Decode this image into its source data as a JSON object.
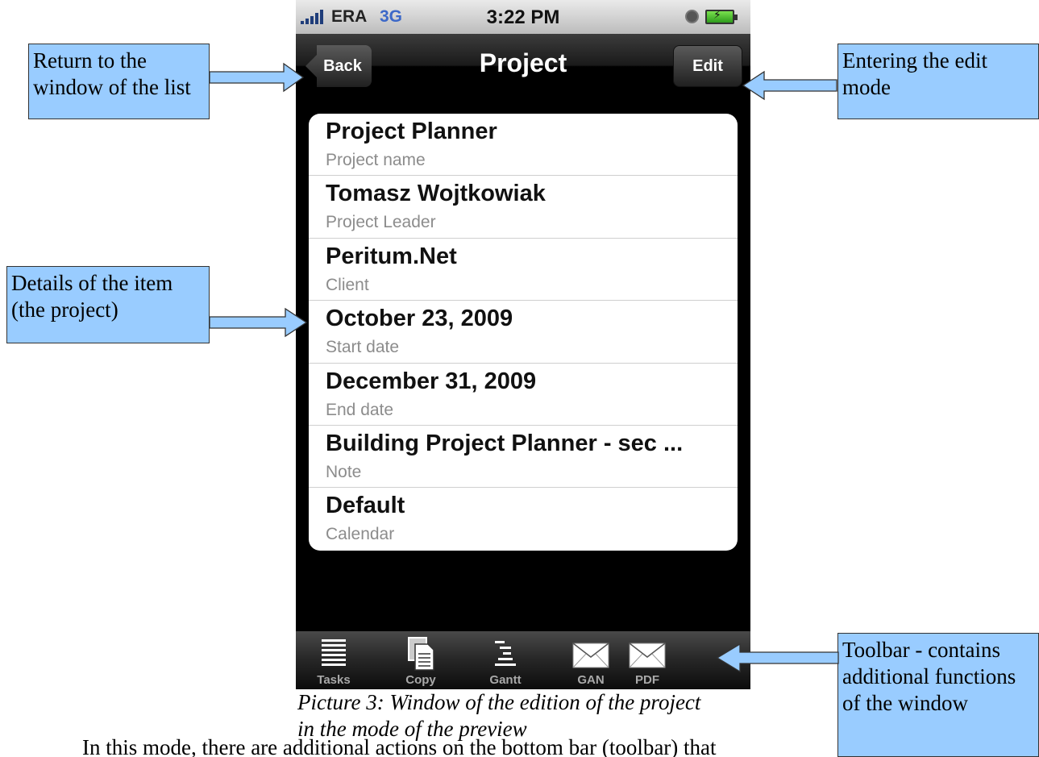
{
  "status_bar": {
    "carrier": "ERA",
    "network": "3G",
    "time": "3:22 PM"
  },
  "nav": {
    "back_label": "Back",
    "title": "Project",
    "edit_label": "Edit"
  },
  "fields": [
    {
      "value": "Project Planner",
      "label": "Project name"
    },
    {
      "value": "Tomasz Wojtkowiak",
      "label": "Project Leader"
    },
    {
      "value": "Peritum.Net",
      "label": "Client"
    },
    {
      "value": "October 23, 2009",
      "label": "Start date"
    },
    {
      "value": "December 31, 2009",
      "label": "End date"
    },
    {
      "value": "Building Project Planner - sec ...",
      "label": "Note"
    },
    {
      "value": "Default",
      "label": "Calendar"
    }
  ],
  "toolbar": [
    {
      "label": "Tasks",
      "icon": "list-icon"
    },
    {
      "label": "Copy",
      "icon": "copy-icon"
    },
    {
      "label": "Gantt",
      "icon": "gantt-icon"
    },
    {
      "label": "GAN",
      "icon": "mail-icon"
    },
    {
      "label": "PDF",
      "icon": "mail-icon"
    }
  ],
  "callouts": {
    "back": "Return to the window of the list",
    "edit": "Entering the edit mode",
    "details": "Details of the item (the project)",
    "toolbar": "Toolbar - contains additional functions of the window"
  },
  "caption": "Picture 3: Window of the edition of the project in the mode of the preview",
  "body_text": "In this mode, there are additional actions on the bottom bar (toolbar) that"
}
